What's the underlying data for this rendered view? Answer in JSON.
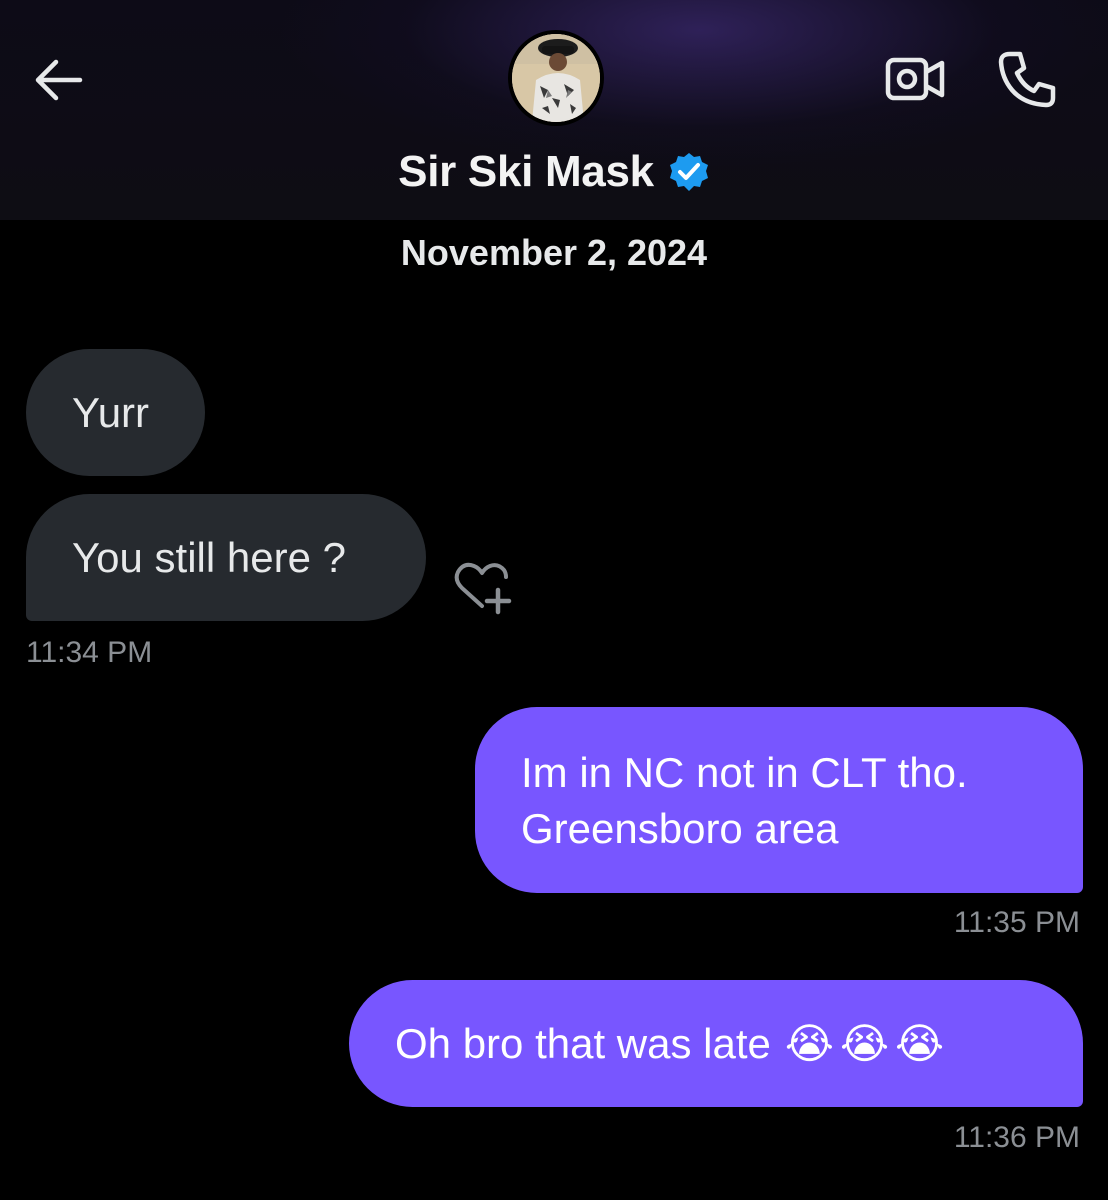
{
  "header": {
    "contact_name": "Sir Ski Mask",
    "verified": true,
    "accent_verified": "#1d9bf0",
    "icons": {
      "back": "arrow-left-icon",
      "video": "video-call-icon",
      "phone": "phone-icon",
      "verified": "verified-badge-icon"
    }
  },
  "conversation": {
    "date_separator": "November 2, 2024",
    "messages": [
      {
        "direction": "incoming",
        "text": "Yurr"
      },
      {
        "direction": "incoming",
        "text": "You still here ?",
        "time": "11:34 PM"
      },
      {
        "direction": "outgoing",
        "text": "Im in NC not in CLT tho. Greensboro area",
        "time": "11:35 PM"
      },
      {
        "direction": "outgoing",
        "text": "Oh bro that was late",
        "emoji": "😭😭😭",
        "time": "11:36 PM"
      }
    ],
    "react_icon": "heart-plus-icon"
  },
  "colors": {
    "outgoing_bubble": "#7856ff",
    "incoming_bubble": "#262a2f",
    "timestamp": "#8b8f94"
  }
}
